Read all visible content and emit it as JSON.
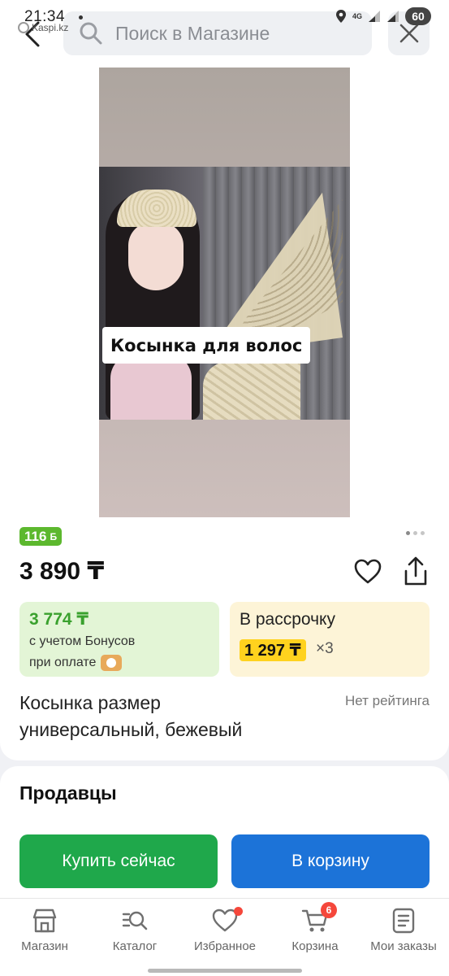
{
  "status_bar": {
    "time": "21:34",
    "network": "4G",
    "battery": "60"
  },
  "header": {
    "app_tag": "Kaspi.kz",
    "search_placeholder": "Поиск в Магазине"
  },
  "product": {
    "image_caption": "Косынка для волос",
    "bonus": "116",
    "bonus_unit": "Б",
    "price": "3 890 ₸",
    "bonus_offer": {
      "price": "3 774 ₸",
      "line1": "с учетом Бонусов",
      "line2": "при оплате"
    },
    "installment": {
      "title": "В рассрочку",
      "amount": "1 297 ₸",
      "times": "×3"
    },
    "title": "Косынка размер универсальный, бежевый",
    "rating": "Нет рейтинга",
    "carousel_total": 3,
    "carousel_active": 1
  },
  "sellers": {
    "title": "Продавцы",
    "buy_label": "Купить сейчас",
    "cart_label": "В корзину"
  },
  "bottom_nav": {
    "items": [
      {
        "label": "Магазин",
        "icon": "shop-icon"
      },
      {
        "label": "Каталог",
        "icon": "catalog-icon"
      },
      {
        "label": "Избранное",
        "icon": "heart-icon"
      },
      {
        "label": "Корзина",
        "icon": "cart-icon",
        "badge": "6"
      },
      {
        "label": "Мои заказы",
        "icon": "orders-icon"
      }
    ]
  },
  "colors": {
    "bonus_green": "#5cb82e",
    "buy_button": "#1fa84b",
    "cart_button": "#1c73d8",
    "installment_chip": "#ffd21e",
    "badge_red": "#f5473b"
  }
}
